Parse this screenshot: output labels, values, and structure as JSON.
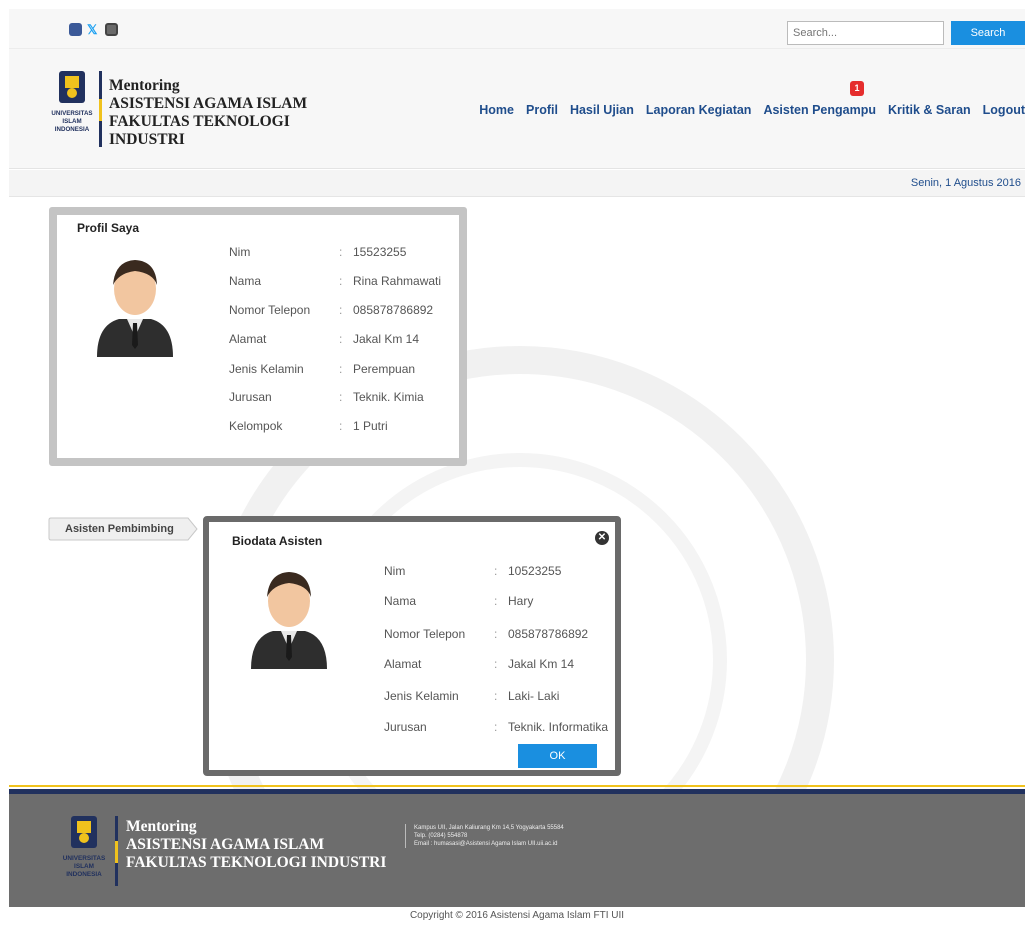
{
  "topbar": {
    "social": [
      "facebook-icon",
      "twitter-icon",
      "instagram-icon"
    ],
    "search_placeholder": "Search...",
    "search_button": "Search"
  },
  "header": {
    "brand_line1": "Mentoring",
    "brand_line2": "ASISTENSI AGAMA ISLAM",
    "brand_line3": "FAKULTAS TEKNOLOGI",
    "brand_line4": "INDUSTRI",
    "logo_text": [
      "UNIVERSITAS",
      "ISLAM",
      "INDONESIA"
    ],
    "nav": [
      "Home",
      "Profil",
      "Hasil Ujian",
      "Laporan Kegiatan",
      "Asisten Pengampu",
      "Kritik & Saran",
      "Logout"
    ],
    "notification_count": "1"
  },
  "date": "Senin, 1 Agustus 2016",
  "profile": {
    "title": "Profil Saya",
    "fields": [
      {
        "label": "Nim",
        "value": "15523255"
      },
      {
        "label": "Nama",
        "value": "Rina Rahmawati"
      },
      {
        "label": "Nomor Telepon",
        "value": "085878786892"
      },
      {
        "label": "Alamat",
        "value": "Jakal Km 14"
      },
      {
        "label": "Jenis Kelamin",
        "value": "Perempuan"
      },
      {
        "label": "Jurusan",
        "value": "Teknik. Kimia"
      },
      {
        "label": "Kelompok",
        "value": "1 Putri"
      }
    ]
  },
  "asisten_tab": "Asisten Pembimbing",
  "modal": {
    "title": "Biodata Asisten",
    "fields": [
      {
        "label": "Nim",
        "value": "10523255"
      },
      {
        "label": "Nama",
        "value": "Hary"
      },
      {
        "label": "Nomor Telepon",
        "value": "085878786892"
      },
      {
        "label": "Alamat",
        "value": "Jakal Km 14"
      },
      {
        "label": "Jenis Kelamin",
        "value": "Laki- Laki"
      },
      {
        "label": "Jurusan",
        "value": "Teknik. Informatika"
      }
    ],
    "ok_button": "OK"
  },
  "footer": {
    "brand_line1": "Mentoring",
    "brand_line2": "ASISTENSI AGAMA ISLAM",
    "brand_line3": "FAKULTAS TEKNOLOGI INDUSTRI",
    "contact_line1": "Kampus UII, Jalan Kaliurang Km 14,5 Yogyakarta 55584",
    "contact_line2": "Telp. (0284) 554878",
    "contact_line3": "Email : humasasi@Asistensi Agama Islam UII.uii.ac.id",
    "copyright": "Copyright © 2016 Asistensi Agama Islam FTI UII"
  },
  "colors": {
    "accent_blue": "#1a8fe0",
    "nav_blue": "#1f4d8c",
    "brand_navy": "#21315e",
    "brand_gold": "#f0c21d",
    "footer_gray": "#6d6d6d"
  }
}
